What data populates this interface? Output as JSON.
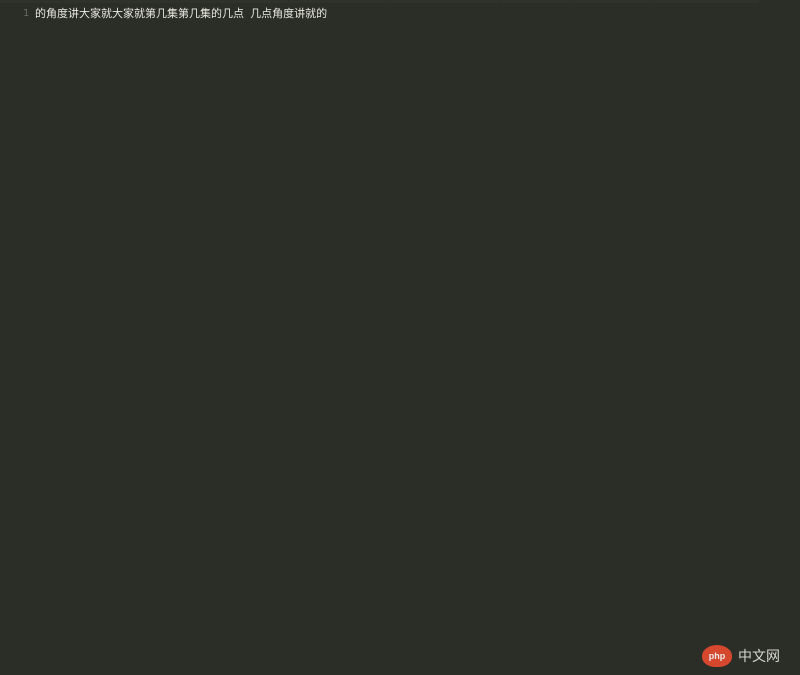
{
  "editor": {
    "lines": [
      {
        "number": "1",
        "content": "的角度讲大家就大家就第几集第几集的几点  几点角度讲就的"
      }
    ]
  },
  "watermark": {
    "logo_text": "php",
    "label": "中文网"
  }
}
